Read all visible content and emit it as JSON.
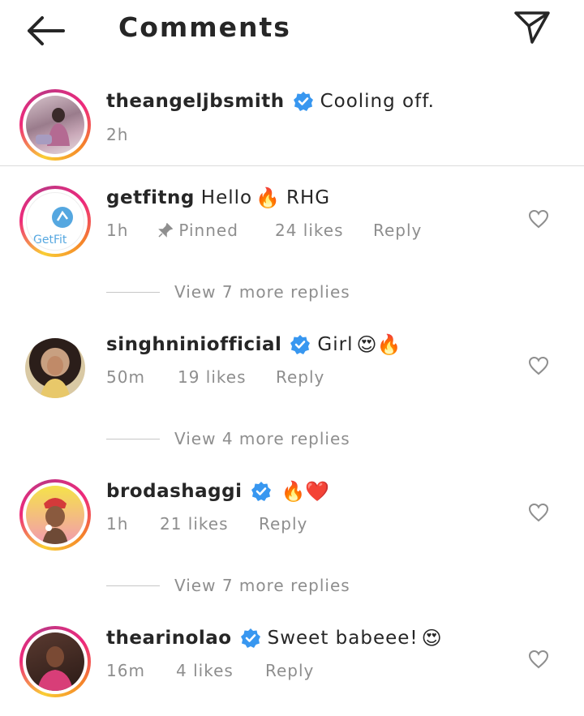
{
  "header": {
    "title": "Comments"
  },
  "caption": {
    "username": "theangeljbsmith",
    "text": "Cooling off.",
    "time": "2h"
  },
  "comments": [
    {
      "username": "getfitng",
      "text": "Hello",
      "emoji": "🔥",
      "text_after": "RHG",
      "time": "1h",
      "pinned": "Pinned",
      "likes": "24 likes",
      "reply": "Reply",
      "view_more": "View 7 more replies",
      "avatar_text": "GetFit"
    },
    {
      "username": "singhniniofficial",
      "text": "Girl",
      "emoji": "😍🔥",
      "time": "50m",
      "likes": "19 likes",
      "reply": "Reply",
      "view_more": "View 4 more replies"
    },
    {
      "username": "brodashaggi",
      "text": "",
      "emoji": "🔥❤️",
      "time": "1h",
      "likes": "21 likes",
      "reply": "Reply",
      "view_more": "View 7 more replies"
    },
    {
      "username": "thearinolao",
      "text": "Sweet babeee!",
      "emoji": "😍",
      "time": "16m",
      "likes": "4 likes",
      "reply": "Reply"
    }
  ],
  "colors": {
    "verified": "#3897f0",
    "muted": "#8e8e8e",
    "text": "#262626"
  }
}
